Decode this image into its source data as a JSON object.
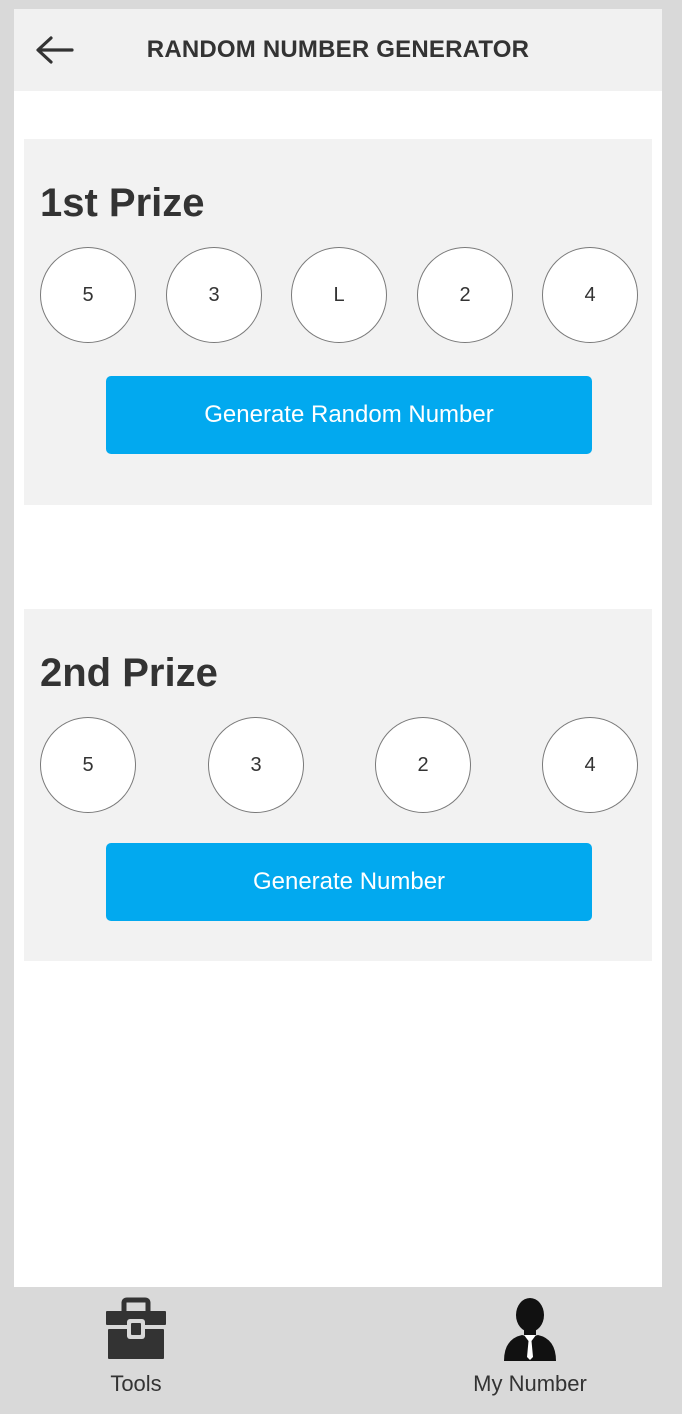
{
  "header": {
    "title": "RANDOM NUMBER GENERATOR",
    "back_icon": "arrow-left-icon"
  },
  "prizes": [
    {
      "title": "1st Prize",
      "balls": [
        "5",
        "3",
        "L",
        "2",
        "4"
      ],
      "button_label": "Generate Random Number"
    },
    {
      "title": "2nd Prize",
      "balls": [
        "5",
        "3",
        "2",
        "4"
      ],
      "button_label": "Generate Number"
    }
  ],
  "bottom_nav": {
    "items": [
      {
        "label": "Tools",
        "icon": "toolbox-icon"
      },
      {
        "label": "My Number",
        "icon": "user-icon"
      }
    ]
  },
  "colors": {
    "accent": "#02a9ef",
    "header_bg": "#f1f1f1",
    "card_bg": "#f2f2f2",
    "nav_bg": "#d9d9d9",
    "text": "#333333"
  }
}
